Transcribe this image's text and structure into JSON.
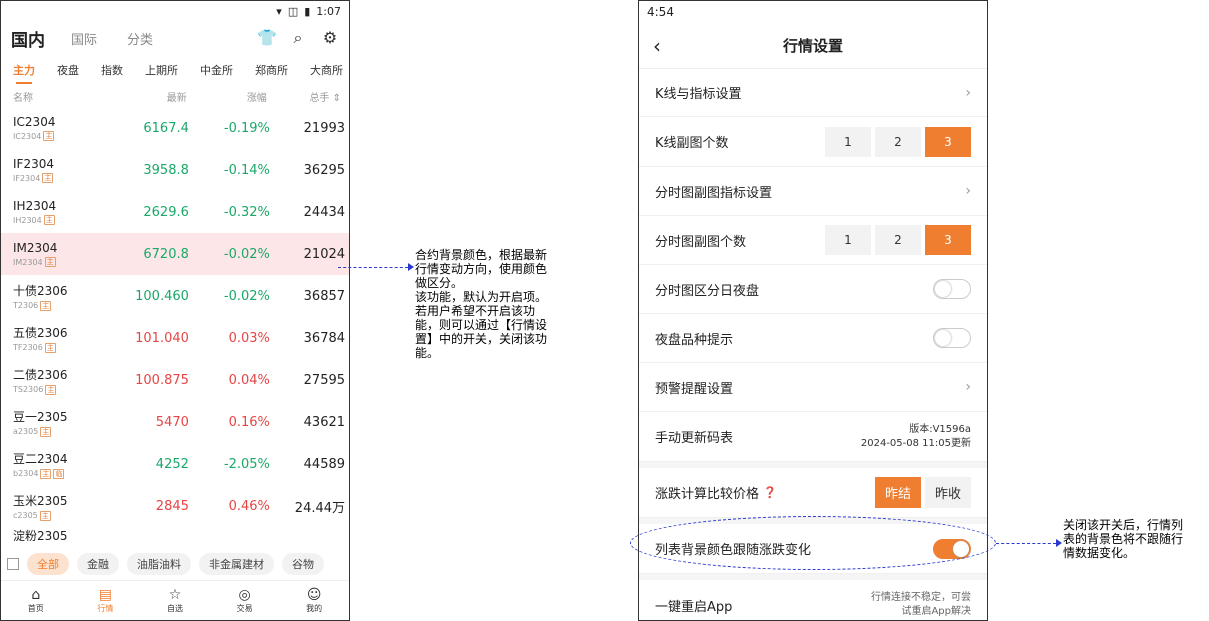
{
  "left": {
    "status": {
      "time": "1:07"
    },
    "top_tabs": [
      "国内",
      "国际",
      "分类"
    ],
    "exchanges": [
      "主力",
      "夜盘",
      "指数",
      "上期所",
      "中金所",
      "郑商所",
      "大商所"
    ],
    "columns": [
      "名称",
      "最新",
      "涨幅",
      "总手 ⇕"
    ],
    "rows": [
      {
        "name": "IC2304",
        "code": "IC2304",
        "badge": "主",
        "last": "6167.4",
        "chg": "-0.19%",
        "vol": "21993",
        "dir": "down"
      },
      {
        "name": "IF2304",
        "code": "IF2304",
        "badge": "主",
        "last": "3958.8",
        "chg": "-0.14%",
        "vol": "36295",
        "dir": "down"
      },
      {
        "name": "IH2304",
        "code": "IH2304",
        "badge": "主",
        "last": "2629.6",
        "chg": "-0.32%",
        "vol": "24434",
        "dir": "down"
      },
      {
        "name": "IM2304",
        "code": "IM2304",
        "badge": "主",
        "last": "6720.8",
        "chg": "-0.02%",
        "vol": "21024",
        "dir": "down"
      },
      {
        "name": "十债2306",
        "code": "T2306",
        "badge": "主",
        "last": "100.460",
        "chg": "-0.02%",
        "vol": "36857",
        "dir": "down"
      },
      {
        "name": "五债2306",
        "code": "TF2306",
        "badge": "主",
        "last": "101.040",
        "chg": "0.03%",
        "vol": "36784",
        "dir": "up"
      },
      {
        "name": "二债2306",
        "code": "TS2306",
        "badge": "主",
        "last": "100.875",
        "chg": "0.04%",
        "vol": "27595",
        "dir": "up"
      },
      {
        "name": "豆一2305",
        "code": "a2305",
        "badge": "主",
        "last": "5470",
        "chg": "0.16%",
        "vol": "43621",
        "dir": "up"
      },
      {
        "name": "豆二2304",
        "code": "b2304",
        "badge": "主",
        "badge2": "临",
        "last": "4252",
        "chg": "-2.05%",
        "vol": "44589",
        "dir": "down"
      },
      {
        "name": "玉米2305",
        "code": "c2305",
        "badge": "主",
        "last": "2845",
        "chg": "0.46%",
        "vol": "24.44万",
        "dir": "up"
      }
    ],
    "partial_row": "淀粉2305",
    "categories": [
      "全部",
      "金融",
      "油脂油料",
      "非金属建材",
      "谷物"
    ],
    "nav": [
      "首页",
      "行情",
      "自选",
      "交易",
      "我的"
    ]
  },
  "right": {
    "status_time": "4:54",
    "title": "行情设置",
    "kline_settings": "K线与指标设置",
    "kline_count": "K线副图个数",
    "kline_options": [
      "1",
      "2",
      "3"
    ],
    "fenshi_settings": "分时图副图指标设置",
    "fenshi_count": "分时图副图个数",
    "fenshi_options": [
      "1",
      "2",
      "3"
    ],
    "day_night": "分时图区分日夜盘",
    "night_hint": "夜盘品种提示",
    "alert": "预警提醒设置",
    "update_table": "手动更新码表",
    "version": "版本:V1596a",
    "version_date": "2024-05-08 11:05更新",
    "price_compare": "涨跌计算比较价格",
    "price_options": [
      "昨结",
      "昨收"
    ],
    "bg_follow": "列表背景颜色跟随涨跌变化",
    "restart": "一键重启App",
    "restart_note_1": "行情连接不稳定，可尝",
    "restart_note_2": "试重启App解决"
  },
  "annotations": {
    "a1": "合约背景颜色，根据最新\n行情变动方向，使用颜色\n做区分。\n该功能，默认为开启项。\n若用户希望不开启该功\n能，则可以通过【行情设\n置】中的开关，关闭该功\n能。",
    "a2": "关闭该开关后，行情列\n表的背景色将不跟随行\n情数据变化。"
  },
  "colors": {
    "accent": "#f07e30",
    "up": "#e64545",
    "down": "#1aa868",
    "highlight": "#fce6e8"
  }
}
